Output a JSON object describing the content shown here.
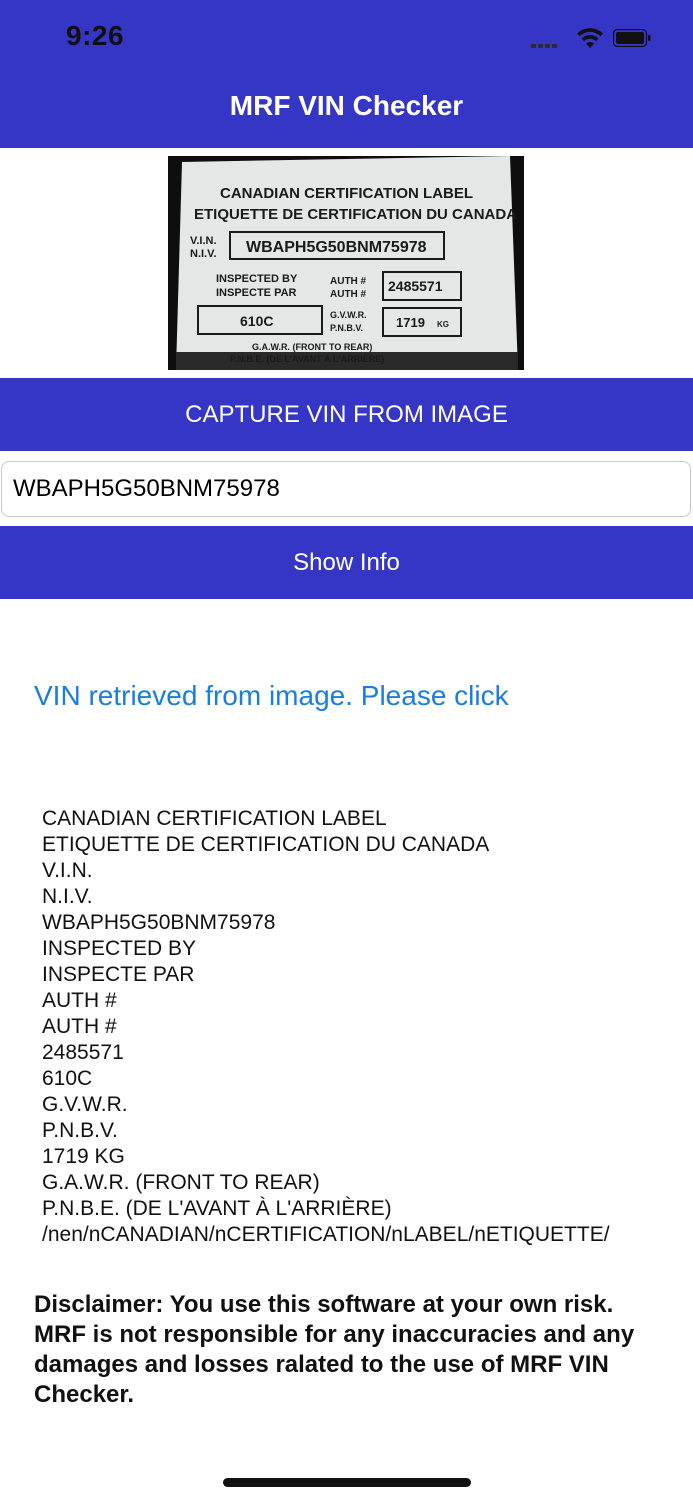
{
  "status_bar": {
    "time": "9:26"
  },
  "nav": {
    "title": "MRF VIN Checker"
  },
  "label_photo": {
    "line1": "CANADIAN CERTIFICATION LABEL",
    "line2": "ETIQUETTE DE CERTIFICATION DU CANADA",
    "vin_tag_a": "V.I.N.",
    "vin_tag_b": "N.I.V.",
    "vin": "WBAPH5G50BNM75978",
    "inspected_a": "INSPECTED BY",
    "inspected_b": "INSPECTE PAR",
    "auth_a": "AUTH #",
    "auth_b": "AUTH #",
    "auth_value": "2485571",
    "code": "610C",
    "gvwr_a": "G.V.W.R.",
    "gvwr_b": "P.N.B.V.",
    "weight": "1719",
    "unit": "KG",
    "gawr": "G.A.W.R. (FRONT TO REAR)",
    "pnbe": "P.N.B.E. (DE L'AVANT À L'ARRIÈRE)"
  },
  "capture_button": {
    "label": "CAPTURE VIN FROM IMAGE"
  },
  "vin_input": {
    "value": "WBAPH5G50BNM75978"
  },
  "show_info_button": {
    "label": "Show Info"
  },
  "status_message": "VIN retrieved from image.  Please click",
  "ocr_lines": [
    "CANADIAN CERTIFICATION LABEL",
    "ETIQUETTE DE CERTIFICATION DU CANADA",
    "V.I.N.",
    "N.I.V.",
    "WBAPH5G50BNM75978",
    "INSPECTED BY",
    "INSPECTE PAR",
    "AUTH #",
    "AUTH #",
    "2485571",
    "610C",
    "G.V.W.R.",
    "P.N.B.V.",
    "1719 KG",
    "G.A.W.R. (FRONT TO REAR)",
    "P.N.B.E. (DE L'AVANT À L'ARRIÈRE)",
    "/nen/nCANADIAN/nCERTIFICATION/nLABEL/nETIQUETTE/"
  ],
  "disclaimer": "Disclaimer: You use this software at your own risk. MRF is not responsible for any inaccuracies and any damages and losses ralated to the use of MRF VIN Checker.",
  "colors": {
    "accent": "#3636c6",
    "link": "#1a7de0",
    "text": "#111111",
    "background": "#ffffff"
  },
  "icons": [
    "cellular-signal-icon",
    "wifi-icon",
    "battery-icon"
  ]
}
